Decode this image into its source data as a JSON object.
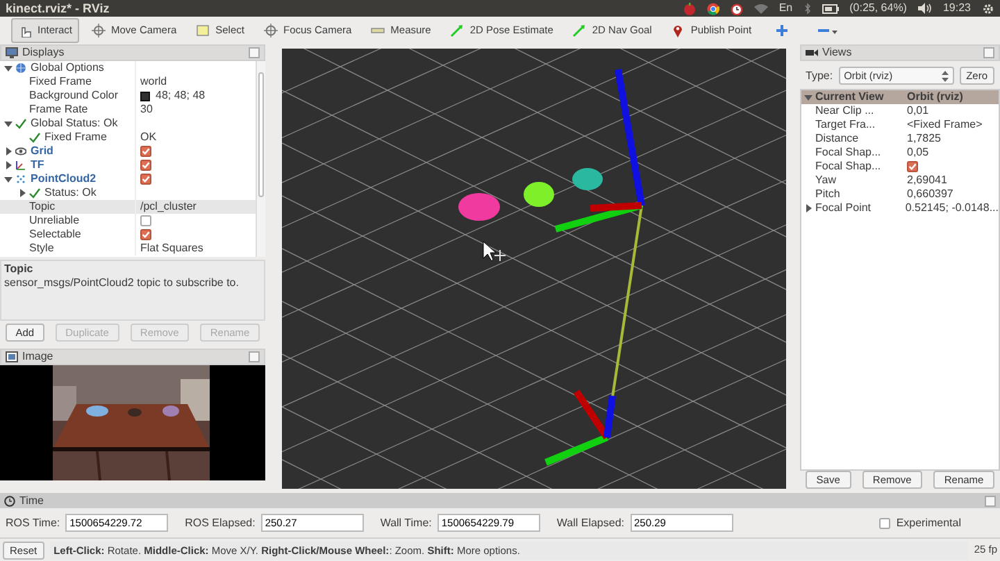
{
  "window": {
    "title": "kinect.rviz* - RViz"
  },
  "tray": {
    "keyboard": "En",
    "battery": "(0:25, 64%)",
    "clock": "19:23"
  },
  "toolbar": [
    {
      "kind": "interact",
      "label": "Interact",
      "selected": true
    },
    {
      "kind": "move",
      "label": "Move Camera",
      "selected": false
    },
    {
      "kind": "select",
      "label": "Select",
      "selected": false
    },
    {
      "kind": "focus",
      "label": "Focus Camera",
      "selected": false
    },
    {
      "kind": "measure",
      "label": "Measure",
      "selected": false
    },
    {
      "kind": "pose",
      "label": "2D Pose Estimate",
      "selected": false
    },
    {
      "kind": "goal",
      "label": "2D Nav Goal",
      "selected": false
    },
    {
      "kind": "point",
      "label": "Publish Point",
      "selected": false
    },
    {
      "kind": "add"
    },
    {
      "kind": "remove"
    }
  ],
  "displays": {
    "title": "Displays",
    "tree": [
      {
        "kind": "group",
        "label": "Global Options",
        "expanded": true,
        "children": [
          {
            "kind": "text",
            "label": "Fixed Frame",
            "value": "world"
          },
          {
            "kind": "color",
            "label": "Background Color",
            "value": "48; 48; 48"
          },
          {
            "kind": "text",
            "label": "Frame Rate",
            "value": "30"
          }
        ]
      },
      {
        "kind": "status",
        "label": "Global Status: Ok",
        "expanded": true,
        "children": [
          {
            "kind": "status",
            "label": "Fixed Frame",
            "value": "OK"
          }
        ]
      },
      {
        "kind": "grid",
        "label": "Grid",
        "checked": true,
        "expanded": false
      },
      {
        "kind": "tf",
        "label": "TF",
        "checked": true,
        "expanded": false
      },
      {
        "kind": "pointcloud",
        "label": "PointCloud2",
        "checked": true,
        "expanded": true,
        "children": [
          {
            "kind": "status",
            "label": "Status: Ok",
            "expanded": false
          },
          {
            "kind": "text",
            "label": "Topic",
            "value": "/pcl_cluster",
            "selected": true
          },
          {
            "kind": "bool",
            "label": "Unreliable",
            "checked": false
          },
          {
            "kind": "bool",
            "label": "Selectable",
            "checked": true
          },
          {
            "kind": "text",
            "label": "Style",
            "value": "Flat Squares"
          }
        ]
      }
    ],
    "description": {
      "title": "Topic",
      "text": "sensor_msgs/PointCloud2 topic to subscribe to."
    },
    "buttons": [
      {
        "label": "Add",
        "disabled": false
      },
      {
        "label": "Duplicate",
        "disabled": true
      },
      {
        "label": "Remove",
        "disabled": true
      },
      {
        "label": "Rename",
        "disabled": true
      }
    ]
  },
  "image": {
    "title": "Image",
    "kind": "picture"
  },
  "views": {
    "title": "Views",
    "type_label": "Type:",
    "type": "Orbit (rviz)",
    "zero": "Zero",
    "header": {
      "label": "Current View",
      "value": "Orbit (rviz)",
      "expanded": true
    },
    "properties": [
      {
        "label": "Near Clip ...",
        "value": "0,01"
      },
      {
        "label": "Target Fra...",
        "value": "<Fixed Frame>"
      },
      {
        "label": "Distance",
        "value": "1,7825"
      },
      {
        "label": "Focal Shap...",
        "value": "0,05"
      },
      {
        "label": "Focal Shap...",
        "checked": true
      },
      {
        "label": "Yaw",
        "value": "2,69041"
      },
      {
        "label": "Pitch",
        "value": "0,660397"
      },
      {
        "label": "Focal Point",
        "value": "0.52145; -0.0148...",
        "expanded": false
      }
    ],
    "buttons": [
      "Save",
      "Remove",
      "Rename"
    ]
  },
  "time": {
    "title": "Time",
    "fields": [
      {
        "label": "ROS Time:",
        "value": "1500654229.72"
      },
      {
        "label": "ROS Elapsed:",
        "value": "250.27"
      },
      {
        "label": "Wall Time:",
        "value": "1500654229.79"
      },
      {
        "label": "Wall Elapsed:",
        "value": "250.29"
      }
    ],
    "experimental": {
      "label": "Experimental",
      "checked": false
    }
  },
  "status_bar": {
    "reset": "Reset",
    "hint": "**Left-Click:** Rotate. **Middle-Click:** Move X/Y. **Right-Click/Mouse Wheel:**: Zoom. **Shift:** More options.",
    "fps": "25 fp"
  }
}
